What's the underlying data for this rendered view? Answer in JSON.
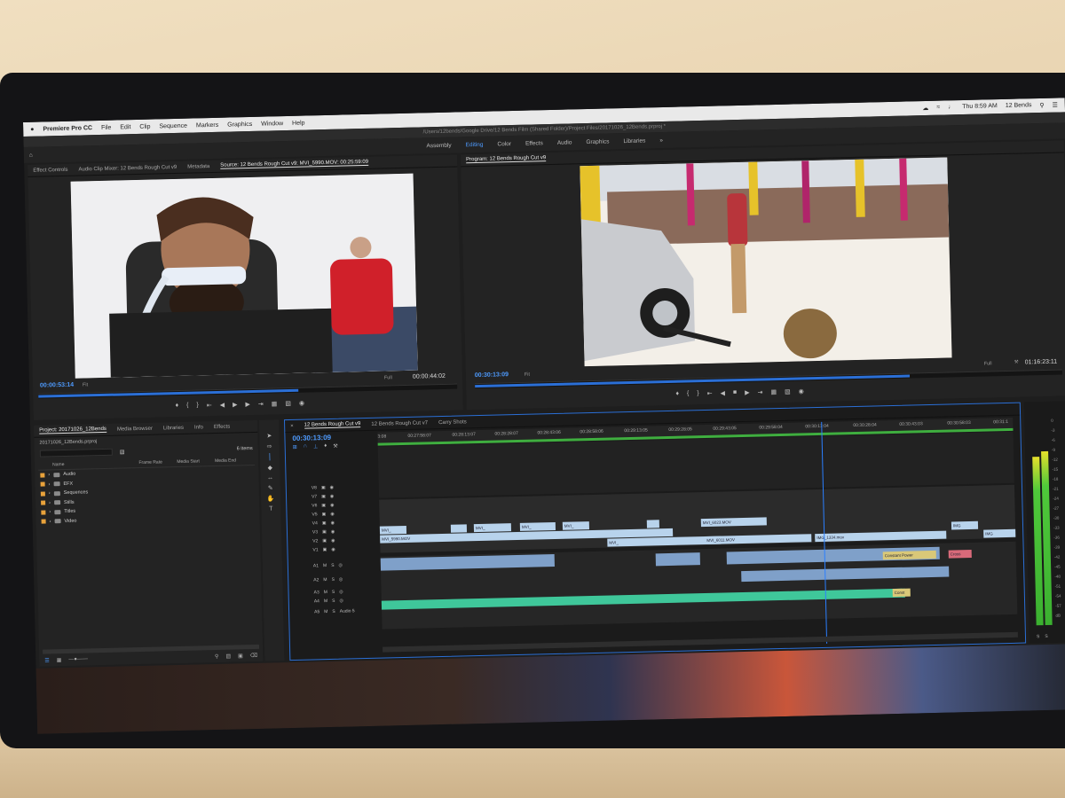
{
  "menubar": {
    "app_name": "Premiere Pro CC",
    "items": [
      "File",
      "Edit",
      "Clip",
      "Sequence",
      "Markers",
      "Graphics",
      "Window",
      "Help"
    ],
    "clock": "Thu 8:59 AM",
    "user": "12 Bends"
  },
  "title_path": "/Users/12bends/Google Drive/12 Bends Film (Shared Folder)/Project Files/20171026_12Bends.prproj *",
  "workspaces": {
    "items": [
      "Assembly",
      "Editing",
      "Color",
      "Effects",
      "Audio",
      "Graphics",
      "Libraries"
    ],
    "active": "Editing"
  },
  "source_panel": {
    "tabs": [
      "Effect Controls",
      "Audio Clip Mixer: 12 Bends Rough Cut v9",
      "Metadata",
      "Source: 12 Bends Rough Cut v9: MVI_5990.MOV: 00:25:59:09"
    ],
    "timecode_in": "00:00:53:14",
    "fit": "Fit",
    "full": "Full",
    "duration": "00:00:44:02"
  },
  "program_panel": {
    "tab": "Program: 12 Bends Rough Cut v9",
    "timecode": "00:30:13:09",
    "fit": "Fit",
    "full": "Full",
    "duration": "01:16:23:11"
  },
  "project_panel": {
    "tabs": [
      "Project: 20171026_12Bends",
      "Media Browser",
      "Libraries",
      "Info",
      "Effects"
    ],
    "file": "20171026_12Bends.prproj",
    "item_count": "6 Items",
    "columns": [
      "Name",
      "Frame Rate",
      "Media Start",
      "Media End"
    ],
    "folders": [
      "Audio",
      "EFX",
      "Sequences",
      "Stills",
      "Titles",
      "Video"
    ]
  },
  "timeline": {
    "tabs": [
      "12 Bends Rough Cut v9",
      "12 Bends Rough Cut v7",
      "Carry Shots"
    ],
    "timecode": "00:30:13:09",
    "ruler": [
      "3:08",
      "00:27:58:07",
      "00:28:13:07",
      "00:28:28:07",
      "00:28:43:06",
      "00:28:58:06",
      "00:29:13:05",
      "00:29:28:05",
      "00:29:43:05",
      "00:29:58:04",
      "00:30:13:04",
      "00:30:28:04",
      "00:30:43:03",
      "00:30:58:03",
      "00:31:1"
    ],
    "video_tracks": [
      "V8",
      "V7",
      "V6",
      "V5",
      "V4",
      "V3",
      "V2",
      "V1"
    ],
    "audio_tracks": [
      "A1",
      "A2",
      "A3",
      "A4",
      "A5"
    ],
    "audio5_label": "Audio 5",
    "clip_labels": {
      "mvi": "MVI_",
      "v_a": "MVI_6023.MOV",
      "v_b": "MVI_6011.MOV",
      "v_c": "MVI_5990.MOV",
      "v_d": "IMG_1334.mov",
      "v_e": "IMG",
      "a_const": "Constant Power",
      "a_cross": "Cross",
      "a_conc": "Const"
    }
  },
  "meters": {
    "scale": [
      "0",
      "-3",
      "-6",
      "-9",
      "-12",
      "-15",
      "-18",
      "-21",
      "-24",
      "-27",
      "-30",
      "-33",
      "-36",
      "-39",
      "-42",
      "-45",
      "-48",
      "-51",
      "-54",
      "-57",
      "dB"
    ],
    "footer": [
      "S",
      "S"
    ]
  }
}
